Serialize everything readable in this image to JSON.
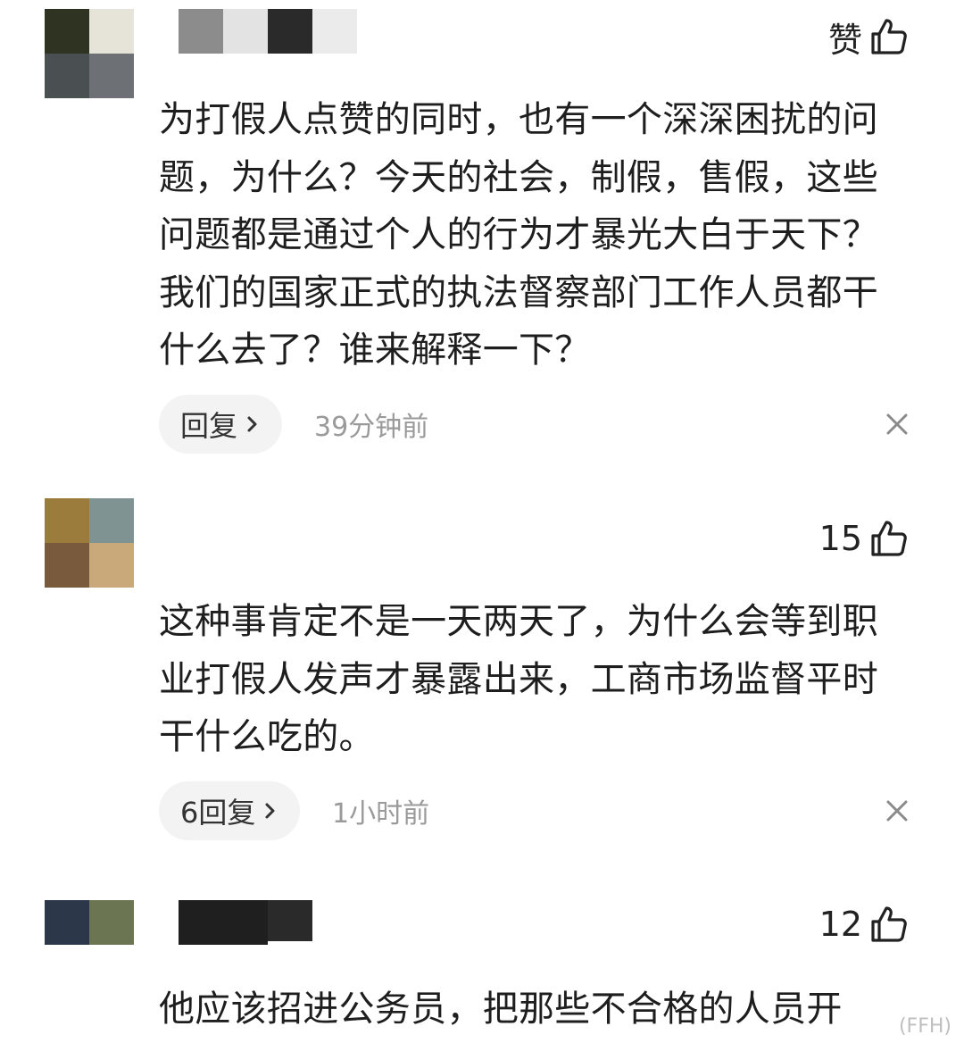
{
  "colors": {
    "text_primary": "#1e1e1e",
    "text_secondary": "#9a9a9a",
    "reply_bg": "#f3f3f3"
  },
  "comments": [
    {
      "like_label": "赞",
      "content": "为打假人点赞的同时，也有一个深深困扰的问题，为什么？今天的社会，制假，售假，这些问题都是通过个人的行为才暴光大白于天下？我们的国家正式的执法督察部门工作人员都干什么去了？谁来解释一下？",
      "reply_label": "回复",
      "time": "39分钟前",
      "avatar_colors": [
        "#2f3322",
        "#e6e3d9",
        "#4a4f52",
        "#6d7075"
      ],
      "username_colors": [
        "#8c8c8c",
        "#e3e3e3",
        "#2a2a2a",
        "#ebebeb"
      ]
    },
    {
      "like_label": "15",
      "content": "这种事肯定不是一天两天了，为什么会等到职业打假人发声才暴露出来，工商市场监督平时干什么吃的。",
      "reply_label": "6回复",
      "time": "1小时前",
      "avatar_colors": [
        "#9b7c3c",
        "#7f9392",
        "#7a5a3c",
        "#c9a97a"
      ]
    },
    {
      "like_label": "12",
      "content": "他应该招进公务员，把那些不合格的人员开",
      "avatar_colors": [
        "#2c3849",
        "#6c7551"
      ],
      "username_colors": [
        "#1f1f1f",
        "#2a2a2a"
      ]
    }
  ],
  "watermark": "(FFH)"
}
